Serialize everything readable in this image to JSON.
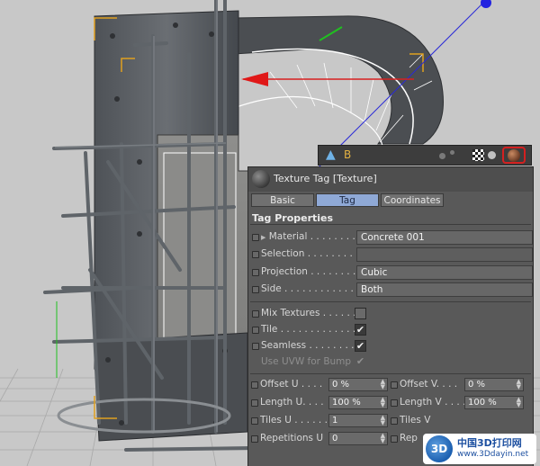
{
  "object_bar": {
    "object_icon": "null-object-icon",
    "object_name": "B",
    "tags": [
      "checker-texture-tag-icon",
      "phong-tag-icon",
      "texture-tag-icon"
    ],
    "selected_tag": "texture-tag-icon",
    "selected_color": "#d42020"
  },
  "attributes": {
    "title": "Texture Tag [Texture]",
    "tabs": [
      {
        "label": "Basic",
        "active": false
      },
      {
        "label": "Tag",
        "active": true
      },
      {
        "label": "Coordinates",
        "active": false
      }
    ],
    "section_title": "Tag Properties",
    "material": {
      "label": "Material . . . . . . . .",
      "value": "Concrete 001"
    },
    "selection": {
      "label": "Selection . . . . . . . .",
      "value": ""
    },
    "projection": {
      "label": "Projection . . . . . . . .",
      "value": "Cubic"
    },
    "side": {
      "label": "Side . . . . . . . . . . . . . .",
      "value": "Both"
    },
    "mix_textures": {
      "label": "Mix Textures . . . . . .",
      "checked": false
    },
    "tile": {
      "label": "Tile . . . . . . . . . . . . .",
      "checked": true
    },
    "seamless": {
      "label": "Seamless . . . . . . . .",
      "checked": true
    },
    "use_uvw": {
      "label": "Use UVW for Bump",
      "checked": true,
      "disabled": true
    },
    "offset_u": {
      "label": "Offset U . . . .",
      "value": "0 %"
    },
    "offset_v": {
      "label": "Offset V. . . .",
      "value": "0 %"
    },
    "length_u": {
      "label": "Length U. . . .",
      "value": "100 %"
    },
    "length_v": {
      "label": "Length V . . . .",
      "value": "100 %"
    },
    "tiles_u": {
      "label": "Tiles U . . . . . .",
      "value": "1"
    },
    "tiles_v": {
      "label": "Tiles V",
      "value": ""
    },
    "repetitions_u": {
      "label": "Repetitions U",
      "value": "0"
    },
    "repetitions_v": {
      "label": "Rep",
      "value": ""
    }
  },
  "watermark": {
    "logo_text": "3D",
    "chinese": "中国3D打印网",
    "url": "www.3Ddayin.net"
  },
  "colors": {
    "panel_bg": "#595959",
    "active_tab": "#8fa9d6",
    "object_name": "#e3b242",
    "viewport_bg": "#c9c9c9"
  }
}
